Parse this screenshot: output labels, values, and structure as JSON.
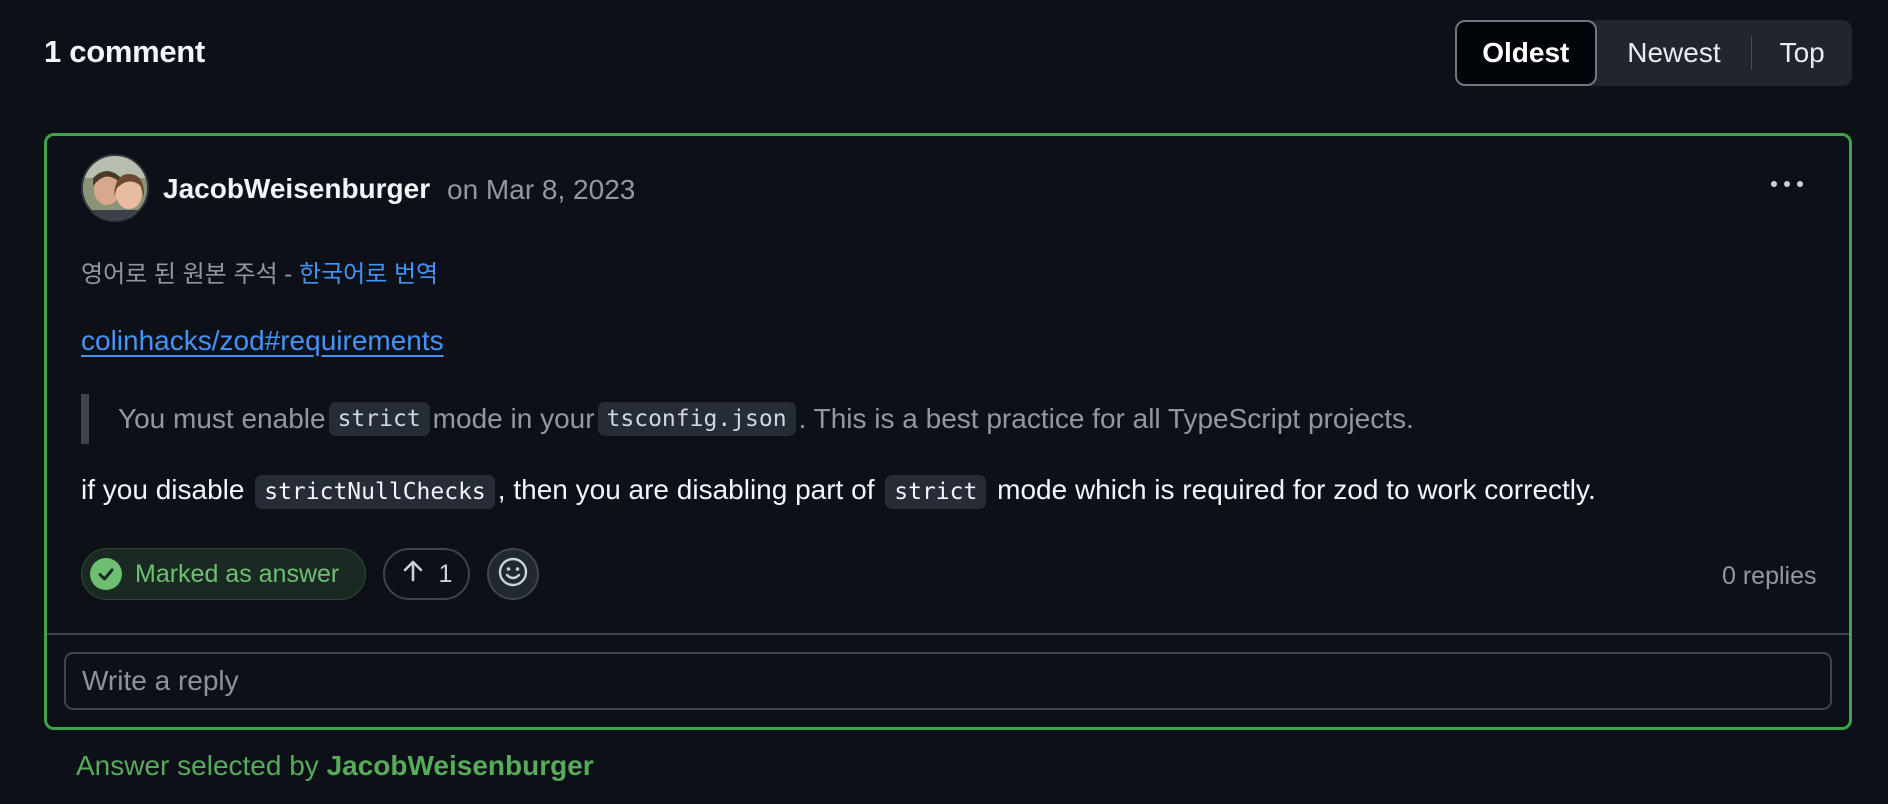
{
  "header": {
    "comment_count": "1 comment"
  },
  "sort": {
    "options": [
      "Oldest",
      "Newest",
      "Top"
    ],
    "selected": "Oldest"
  },
  "comment": {
    "author": "JacobWeisenburger",
    "date": "on Mar 8, 2023",
    "translate_prefix": "영어로 된 원본 주석 - ",
    "translate_link": "한국어로 번역",
    "link": "colinhacks/zod#requirements",
    "quote": {
      "part1": "You must enable ",
      "code1": "strict",
      "part2": " mode in your ",
      "code2": "tsconfig.json",
      "part3": ". This is a best practice for all TypeScript projects."
    },
    "body": {
      "part1": "if you disable ",
      "code1": "strictNullChecks",
      "part2": ", then you are disabling part of ",
      "code2": "strict",
      "part3": " mode which is required for zod to work correctly."
    },
    "marked_label": "Marked as answer",
    "upvotes": "1",
    "replies": "0 replies",
    "reply_placeholder": "Write a reply"
  },
  "footer": {
    "answer_prefix": "Answer selected by ",
    "answer_user": "JacobWeisenburger"
  },
  "colors": {
    "background": "#0d1117",
    "answer_border": "#3fa34d",
    "link": "#4493f8",
    "answer_green": "#57ab5a"
  },
  "icons": [
    "more-horizontal-icon",
    "check-circle-icon",
    "arrow-up-icon",
    "smiley-icon"
  ]
}
